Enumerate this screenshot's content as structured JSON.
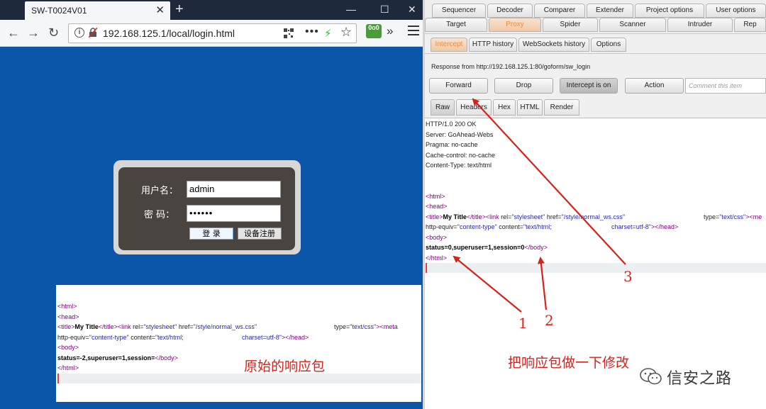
{
  "firefox": {
    "tab_title": "SW-T0024V01",
    "url": "192.168.125.1/local/login.html",
    "extension_badge": "0o0"
  },
  "login": {
    "username_label": "用户名：",
    "username_value": "admin",
    "password_label": "密 码：",
    "password_value": "••••••",
    "login_button": "登 录",
    "register_button": "设备注册"
  },
  "original_response": {
    "caption": "原始的响应包",
    "lines": {
      "html_open": "<html>",
      "head_open": "<head>",
      "title_open": "<title>",
      "title_text": "My Title",
      "title_close": "</title>",
      "link_tag": "<link",
      "rel_attr": " rel=",
      "rel_val": "\"stylesheet\"",
      "href_attr": " href=",
      "href_val": "\"/style/normal_ws.css\"",
      "type_attr": "type=",
      "type_val": "\"text/css\"",
      "meta_tail": "><meta",
      "http_equiv_attr": "http-equiv=",
      "http_equiv_val": "\"content-type\"",
      "content_attr": " content=",
      "content_val": "\"text/html;",
      "charset_val": "charset=utf-8\"",
      "head_close": "></head>",
      "body_open": "<body>",
      "status_text": "status=-2,superuser=1,session=",
      "body_close": "</body>",
      "html_close": "</html>"
    }
  },
  "burp": {
    "top_tabs_row1": [
      "Sequencer",
      "Decoder",
      "Comparer",
      "Extender",
      "Project options",
      "User options"
    ],
    "top_tabs_row2": [
      "Target",
      "Proxy",
      "Spider",
      "Scanner",
      "Intruder",
      "Rep"
    ],
    "sub_tabs": [
      "Intercept",
      "HTTP history",
      "WebSockets history",
      "Options"
    ],
    "response_from": "Response from http://192.168.125.1:80/goform/sw_login",
    "buttons": {
      "forward": "Forward",
      "drop": "Drop",
      "intercept": "Intercept is on",
      "action": "Action"
    },
    "comment_placeholder": "Comment this item",
    "view_tabs": [
      "Raw",
      "Headers",
      "Hex",
      "HTML",
      "Render"
    ],
    "headers": [
      "HTTP/1.0 200 OK",
      "Server: GoAhead-Webs",
      "Pragma: no-cache",
      "Cache-control: no-cache",
      "Content-Type: text/html"
    ],
    "body": {
      "status_text": "status=0,superuser=1,session=0",
      "meta_tail_cut": "><me"
    }
  },
  "annotations": {
    "modify_caption": "把响应包做一下修改",
    "n1": "1",
    "n2": "2",
    "n3": "3",
    "watermark": "信安之路"
  },
  "colors": {
    "login_page_bg": "#0b56a8",
    "annotation_red": "#d6221b",
    "proxy_tab_orange": "#f08a3a",
    "html_tag_purple": "#800080"
  }
}
